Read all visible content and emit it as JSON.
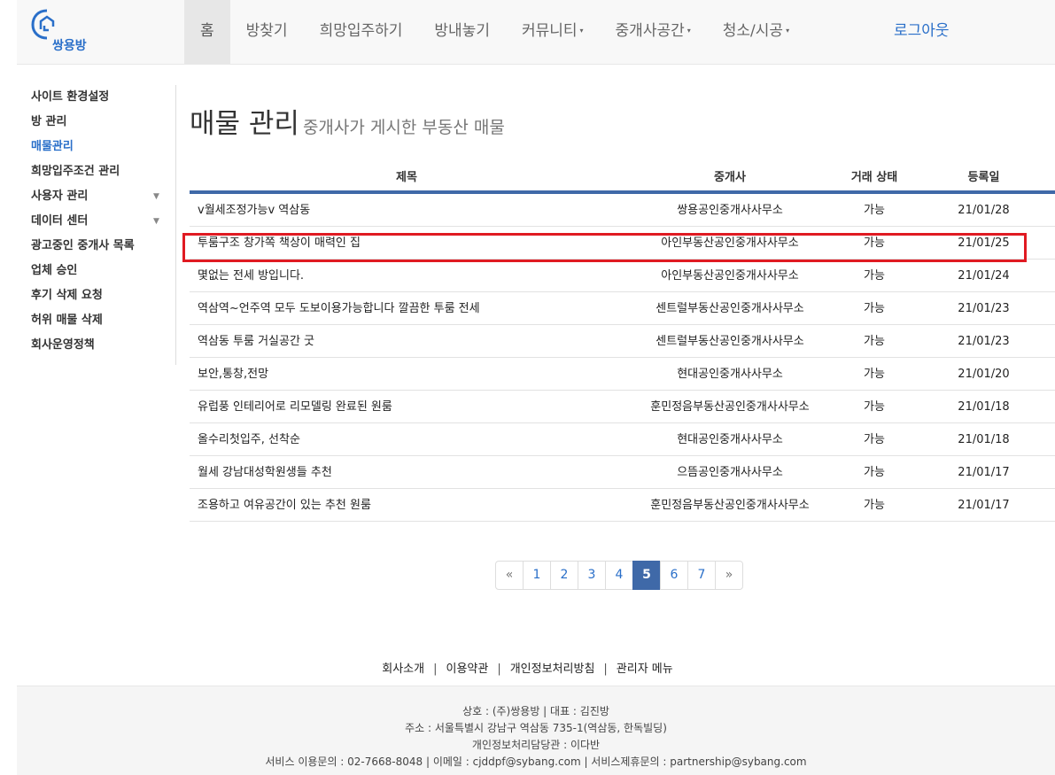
{
  "brand": {
    "name": "쌍용방",
    "color": "#2a6fc9"
  },
  "nav": {
    "items": [
      {
        "label": "홈",
        "active": true,
        "dropdown": false
      },
      {
        "label": "방찾기",
        "active": false,
        "dropdown": false
      },
      {
        "label": "희망입주하기",
        "active": false,
        "dropdown": false
      },
      {
        "label": "방내놓기",
        "active": false,
        "dropdown": false
      },
      {
        "label": "커뮤니티",
        "active": false,
        "dropdown": true
      },
      {
        "label": "중개사공간",
        "active": false,
        "dropdown": true
      },
      {
        "label": "청소/시공",
        "active": false,
        "dropdown": true
      }
    ],
    "logout_label": "로그아웃"
  },
  "sidebar": {
    "items": [
      {
        "label": "사이트 환경설정",
        "active": false,
        "expandable": false
      },
      {
        "label": "방 관리",
        "active": false,
        "expandable": false
      },
      {
        "label": "매물관리",
        "active": true,
        "expandable": false
      },
      {
        "label": "희망입주조건 관리",
        "active": false,
        "expandable": false
      },
      {
        "label": "사용자 관리",
        "active": false,
        "expandable": true
      },
      {
        "label": "데이터 센터",
        "active": false,
        "expandable": true
      },
      {
        "label": "광고중인 중개사 목록",
        "active": false,
        "expandable": false
      },
      {
        "label": "업체 승인",
        "active": false,
        "expandable": false
      },
      {
        "label": "후기 삭제 요청",
        "active": false,
        "expandable": false
      },
      {
        "label": "허위 매물 삭제",
        "active": false,
        "expandable": false
      },
      {
        "label": "회사운영정책",
        "active": false,
        "expandable": false
      }
    ]
  },
  "page": {
    "title": "매물 관리",
    "subtitle": "중개사가 게시한 부동산 매물"
  },
  "table": {
    "headers": {
      "title": "제목",
      "agent": "중개사",
      "status": "거래 상태",
      "date": "등록일"
    },
    "rows": [
      {
        "title": "v월세조정가능v 역삼동",
        "agent": "쌍용공인중개사사무소",
        "status": "가능",
        "date": "21/01/28"
      },
      {
        "title": "투룸구조 창가쪽 책상이 매력인 집",
        "agent": "아인부동산공인중개사사무소",
        "status": "가능",
        "date": "21/01/25",
        "highlighted": true
      },
      {
        "title": "몇없는 전세 방입니다.",
        "agent": "아인부동산공인중개사사무소",
        "status": "가능",
        "date": "21/01/24"
      },
      {
        "title": "역삼역~언주역 모두 도보이용가능합니다 깔끔한 투룸 전세",
        "agent": "센트럴부동산공인중개사사무소",
        "status": "가능",
        "date": "21/01/23"
      },
      {
        "title": "역삼동 투룸 거실공간 굿",
        "agent": "센트럴부동산공인중개사사무소",
        "status": "가능",
        "date": "21/01/23"
      },
      {
        "title": "보안,통창,전망",
        "agent": "현대공인중개사사무소",
        "status": "가능",
        "date": "21/01/20"
      },
      {
        "title": "유럽풍 인테리어로 리모델링 완료된 원룸",
        "agent": "훈민정음부동산공인중개사사무소",
        "status": "가능",
        "date": "21/01/18"
      },
      {
        "title": "올수리첫입주, 선착순",
        "agent": "현대공인중개사사무소",
        "status": "가능",
        "date": "21/01/18"
      },
      {
        "title": "월세 강남대성학원생들 추천",
        "agent": "으뜸공인중개사사무소",
        "status": "가능",
        "date": "21/01/17"
      },
      {
        "title": "조용하고 여유공간이 있는 추천 원룸",
        "agent": "훈민정음부동산공인중개사사무소",
        "status": "가능",
        "date": "21/01/17"
      }
    ]
  },
  "pagination": {
    "prev": "«",
    "next": "»",
    "pages": [
      "1",
      "2",
      "3",
      "4",
      "5",
      "6",
      "7"
    ],
    "current": "5"
  },
  "footer": {
    "links": [
      "회사소개",
      "이용약관",
      "개인정보처리방침",
      "관리자 메뉴"
    ],
    "lines": [
      "상호 : (주)쌍용방 | 대표 : 김진방",
      "주소 : 서울특별시 강남구 역삼동 735-1(역삼동, 한독빌딩)",
      "개인정보처리담당관 : 이다반",
      "서비스 이용문의 : 02-7668-8048 | 이메일 : cjddpf@sybang.com | 서비스제휴문의 : partnership@sybang.com"
    ]
  },
  "colors": {
    "accent": "#3f69a8",
    "highlight_border": "#e01a22",
    "link": "#2a6fc9"
  }
}
